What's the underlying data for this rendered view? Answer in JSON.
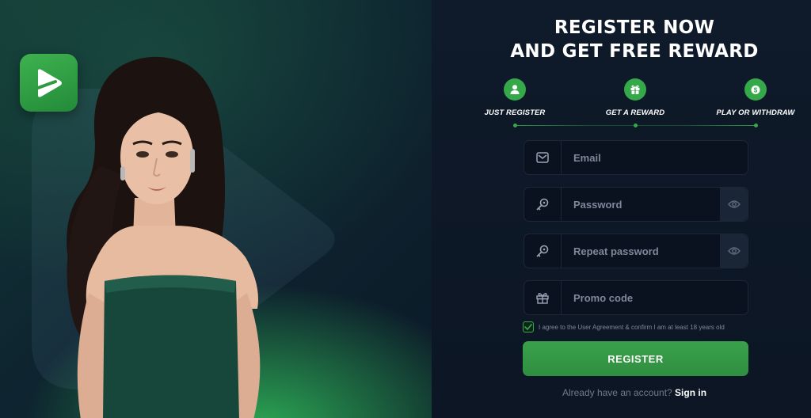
{
  "hero": {
    "logo_icon": "play-icon",
    "brand_color": "#35a849"
  },
  "headline": {
    "line1": "REGISTER NOW",
    "line2": "AND GET FREE REWARD"
  },
  "steps": [
    {
      "label": "JUST REGISTER",
      "icon": "user-icon"
    },
    {
      "label": "GET A REWARD",
      "icon": "gift-icon"
    },
    {
      "label": "PLAY OR WITHDRAW",
      "icon": "money-icon"
    }
  ],
  "form": {
    "email": {
      "placeholder": "Email",
      "value": "",
      "icon": "envelope-icon"
    },
    "password": {
      "placeholder": "Password",
      "value": "",
      "icon": "key-icon"
    },
    "repeat_password": {
      "placeholder": "Repeat password",
      "value": "",
      "icon": "key-icon"
    },
    "promo": {
      "placeholder": "Promo code",
      "value": "",
      "icon": "gift-icon"
    },
    "agree_checked": true,
    "agree_text": "I agree to the User Agreement & confirm I am at least 18 years old",
    "register_label": "REGISTER",
    "signin_question": "Already have an account?",
    "signin_label": "Sign in"
  },
  "colors": {
    "accent": "#35a849",
    "panel_bg": "#0f1a2a",
    "input_bg": "#0a1220"
  }
}
